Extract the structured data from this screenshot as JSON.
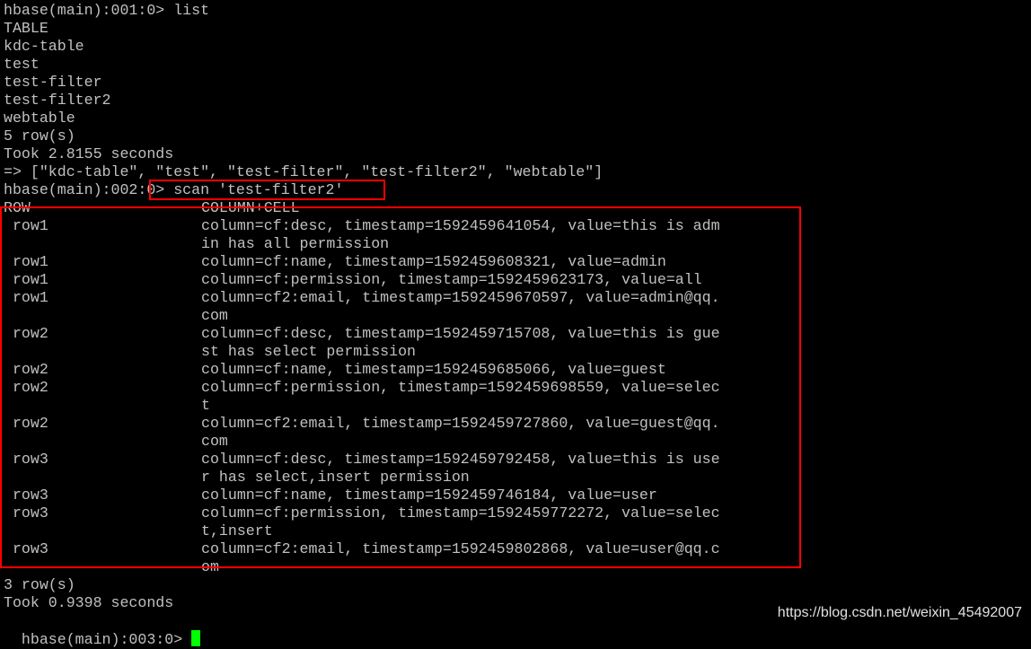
{
  "lines": [
    {
      "text": "hbase(main):001:0> list"
    },
    {
      "text": "TABLE"
    },
    {
      "text": "kdc-table"
    },
    {
      "text": "test"
    },
    {
      "text": "test-filter"
    },
    {
      "text": "test-filter2"
    },
    {
      "text": "webtable"
    },
    {
      "text": "5 row(s)"
    },
    {
      "text": "Took 2.8155 seconds"
    },
    {
      "text": "=> [\"kdc-table\", \"test\", \"test-filter\", \"test-filter2\", \"webtable\"]"
    },
    {
      "text": "hbase(main):002:0> scan 'test-filter2'"
    },
    {
      "text": "ROW",
      "cell": "COLUMN+CELL"
    },
    {
      "text": " row1",
      "cell": "column=cf:desc, timestamp=1592459641054, value=this is adm"
    },
    {
      "text": "",
      "cell": "in has all permission"
    },
    {
      "text": " row1",
      "cell": "column=cf:name, timestamp=1592459608321, value=admin"
    },
    {
      "text": " row1",
      "cell": "column=cf:permission, timestamp=1592459623173, value=all"
    },
    {
      "text": " row1",
      "cell": "column=cf2:email, timestamp=1592459670597, value=admin@qq."
    },
    {
      "text": "",
      "cell": "com"
    },
    {
      "text": " row2",
      "cell": "column=cf:desc, timestamp=1592459715708, value=this is gue"
    },
    {
      "text": "",
      "cell": "st has select permission"
    },
    {
      "text": " row2",
      "cell": "column=cf:name, timestamp=1592459685066, value=guest"
    },
    {
      "text": " row2",
      "cell": "column=cf:permission, timestamp=1592459698559, value=selec"
    },
    {
      "text": "",
      "cell": "t"
    },
    {
      "text": " row2",
      "cell": "column=cf2:email, timestamp=1592459727860, value=guest@qq."
    },
    {
      "text": "",
      "cell": "com"
    },
    {
      "text": " row3",
      "cell": "column=cf:desc, timestamp=1592459792458, value=this is use"
    },
    {
      "text": "",
      "cell": "r has select,insert permission"
    },
    {
      "text": " row3",
      "cell": "column=cf:name, timestamp=1592459746184, value=user"
    },
    {
      "text": " row3",
      "cell": "column=cf:permission, timestamp=1592459772272, value=selec"
    },
    {
      "text": "",
      "cell": "t,insert"
    },
    {
      "text": " row3",
      "cell": "column=cf2:email, timestamp=1592459802868, value=user@qq.c"
    },
    {
      "text": "",
      "cell": "om"
    },
    {
      "text": "3 row(s)"
    },
    {
      "text": "Took 0.9398 seconds"
    }
  ],
  "prompt": "hbase(main):003:0> ",
  "watermark": "https://blog.csdn.net/weixin_45492007",
  "colors": {
    "background": "#000000",
    "text": "#c0c0c0",
    "highlight_box": "#ff0000",
    "cursor": "#00ff00"
  }
}
